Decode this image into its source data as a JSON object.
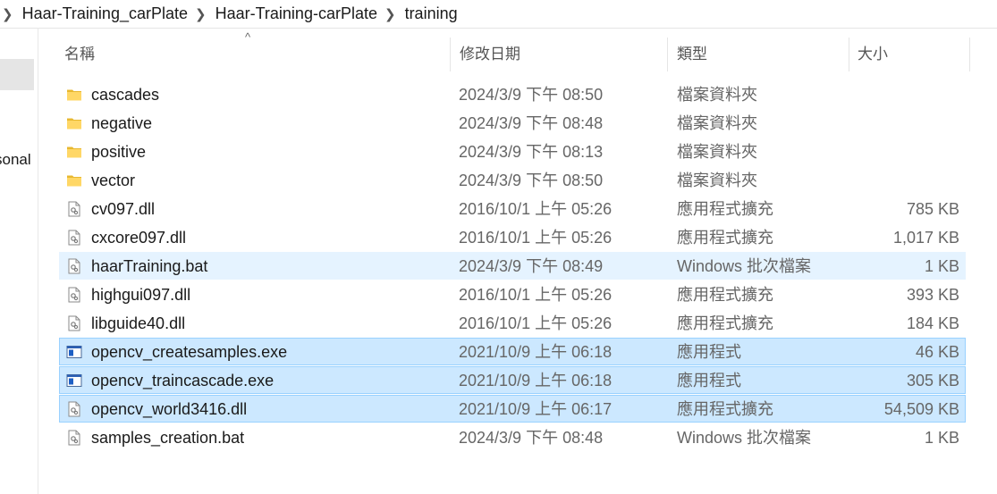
{
  "breadcrumb": {
    "items": [
      "Haar-Training_carPlate",
      "Haar-Training-carPlate",
      "training"
    ]
  },
  "nav": {
    "partial_text": "sonal"
  },
  "columns": {
    "name": "名稱",
    "date": "修改日期",
    "type": "類型",
    "size": "大小",
    "sort_indicator": "^"
  },
  "files": [
    {
      "icon": "folder-icon",
      "name": "cascades",
      "date": "2024/3/9 下午 08:50",
      "type": "檔案資料夾",
      "size": "",
      "state": "normal"
    },
    {
      "icon": "folder-icon",
      "name": "negative",
      "date": "2024/3/9 下午 08:48",
      "type": "檔案資料夾",
      "size": "",
      "state": "normal"
    },
    {
      "icon": "folder-icon",
      "name": "positive",
      "date": "2024/3/9 下午 08:13",
      "type": "檔案資料夾",
      "size": "",
      "state": "normal"
    },
    {
      "icon": "folder-icon",
      "name": "vector",
      "date": "2024/3/9 下午 08:50",
      "type": "檔案資料夾",
      "size": "",
      "state": "normal"
    },
    {
      "icon": "dll-file-icon",
      "name": "cv097.dll",
      "date": "2016/10/1 上午 05:26",
      "type": "應用程式擴充",
      "size": "785 KB",
      "state": "normal"
    },
    {
      "icon": "dll-file-icon",
      "name": "cxcore097.dll",
      "date": "2016/10/1 上午 05:26",
      "type": "應用程式擴充",
      "size": "1,017 KB",
      "state": "normal"
    },
    {
      "icon": "bat-file-icon",
      "name": "haarTraining.bat",
      "date": "2024/3/9 下午 08:49",
      "type": "Windows 批次檔案",
      "size": "1 KB",
      "state": "hover"
    },
    {
      "icon": "dll-file-icon",
      "name": "highgui097.dll",
      "date": "2016/10/1 上午 05:26",
      "type": "應用程式擴充",
      "size": "393 KB",
      "state": "normal"
    },
    {
      "icon": "dll-file-icon",
      "name": "libguide40.dll",
      "date": "2016/10/1 上午 05:26",
      "type": "應用程式擴充",
      "size": "184 KB",
      "state": "normal"
    },
    {
      "icon": "exe-file-icon",
      "name": "opencv_createsamples.exe",
      "date": "2021/10/9 上午 06:18",
      "type": "應用程式",
      "size": "46 KB",
      "state": "selected"
    },
    {
      "icon": "exe-file-icon",
      "name": "opencv_traincascade.exe",
      "date": "2021/10/9 上午 06:18",
      "type": "應用程式",
      "size": "305 KB",
      "state": "selected"
    },
    {
      "icon": "dll-file-icon",
      "name": "opencv_world3416.dll",
      "date": "2021/10/9 上午 06:17",
      "type": "應用程式擴充",
      "size": "54,509 KB",
      "state": "selected"
    },
    {
      "icon": "bat-file-icon",
      "name": "samples_creation.bat",
      "date": "2024/3/9 下午 08:48",
      "type": "Windows 批次檔案",
      "size": "1 KB",
      "state": "normal"
    }
  ]
}
